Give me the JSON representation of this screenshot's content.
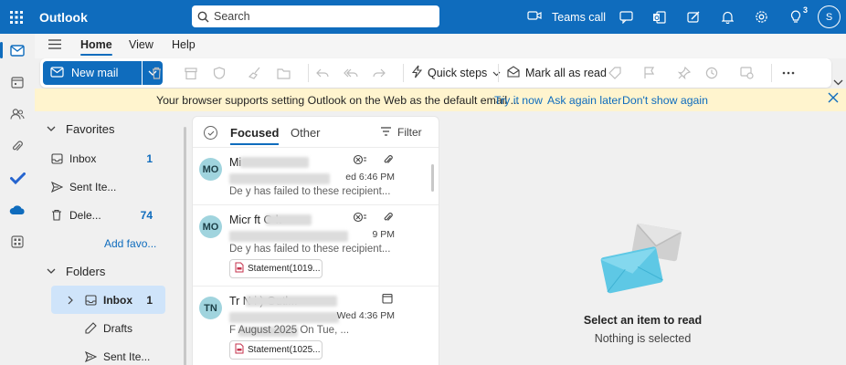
{
  "topbar": {
    "app_title": "Outlook",
    "search_placeholder": "Search",
    "teams_call_label": "Teams call",
    "notification_badge": "3",
    "avatar_initial": "S",
    "accent": "#0f6cbd"
  },
  "menu": {
    "tabs": [
      "Home",
      "View",
      "Help"
    ]
  },
  "ribbon": {
    "new_mail": "New mail",
    "quick_steps": "Quick steps",
    "mark_all_read": "Mark all as read"
  },
  "infobar": {
    "message": "Your browser supports setting Outlook on the Web as the default email ...",
    "try_it_now": "Try it now",
    "ask_later": "Ask again later",
    "dont_show": "Don't show again",
    "bg": "#fff4ce"
  },
  "folders": {
    "favorites_label": "Favorites",
    "favorites": [
      {
        "label": "Inbox",
        "count": "1",
        "icon": "inbox-icon"
      },
      {
        "label": "Sent Ite...",
        "count": "",
        "icon": "send-icon"
      },
      {
        "label": "Dele...",
        "count": "74",
        "icon": "trash-icon"
      }
    ],
    "add_favorite": "Add favo...",
    "folders_label": "Folders",
    "folder_items": [
      {
        "label": "Inbox",
        "count": "1",
        "icon": "inbox-icon",
        "selected": true
      },
      {
        "label": "Drafts",
        "count": "",
        "icon": "drafts-icon"
      },
      {
        "label": "Sent Ite...",
        "count": "",
        "icon": "send-icon"
      }
    ]
  },
  "message_list": {
    "focused_tab": "Focused",
    "other_tab": "Other",
    "filter_label": "Filter",
    "messages": [
      {
        "initials": "MO",
        "sender": "Mi",
        "time": "ed 6:46 PM",
        "preview": "De       y has failed to these recipient..."
      },
      {
        "initials": "MO",
        "sender": "Micr    ft O   k",
        "time": "9 PM",
        "preview": "De       y has failed to these recipient...",
        "attachment": "Statement(1019..."
      },
      {
        "initials": "TN",
        "sender": "Tr        N         i    ) Outl...",
        "time": "Wed 4:36 PM",
        "preview": "F                    August 2025 On Tue, ...",
        "attachment": "Statement(1025..."
      }
    ]
  },
  "reading_pane": {
    "title": "Select an item to read",
    "subtitle": "Nothing is selected"
  }
}
